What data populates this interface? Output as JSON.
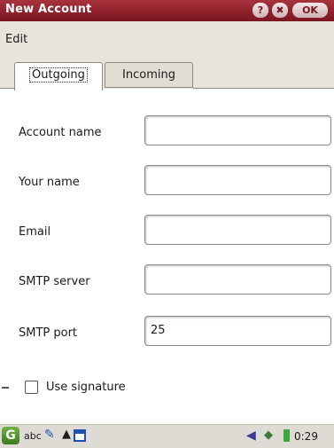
{
  "window": {
    "title": "New Account",
    "buttons": {
      "help": "?",
      "close": "✖",
      "ok": "OK"
    }
  },
  "menu": {
    "items": [
      "Edit"
    ]
  },
  "tabs": [
    {
      "label": "Outgoing",
      "active": true
    },
    {
      "label": "Incoming",
      "active": false
    }
  ],
  "form": {
    "fields": [
      {
        "label": "Account name",
        "value": ""
      },
      {
        "label": "Your name",
        "value": ""
      },
      {
        "label": "Email",
        "value": ""
      },
      {
        "label": "SMTP server",
        "value": ""
      },
      {
        "label": "SMTP port",
        "value": "25"
      }
    ],
    "signature_checkbox": {
      "label": "Use signature",
      "checked": false
    }
  },
  "statusbar": {
    "input_mode": "abc",
    "time": "0:29"
  },
  "colors": {
    "titlebar": "#8b1e28",
    "menubar": "#e8e4dc",
    "statusbar": "#dedbd4"
  }
}
